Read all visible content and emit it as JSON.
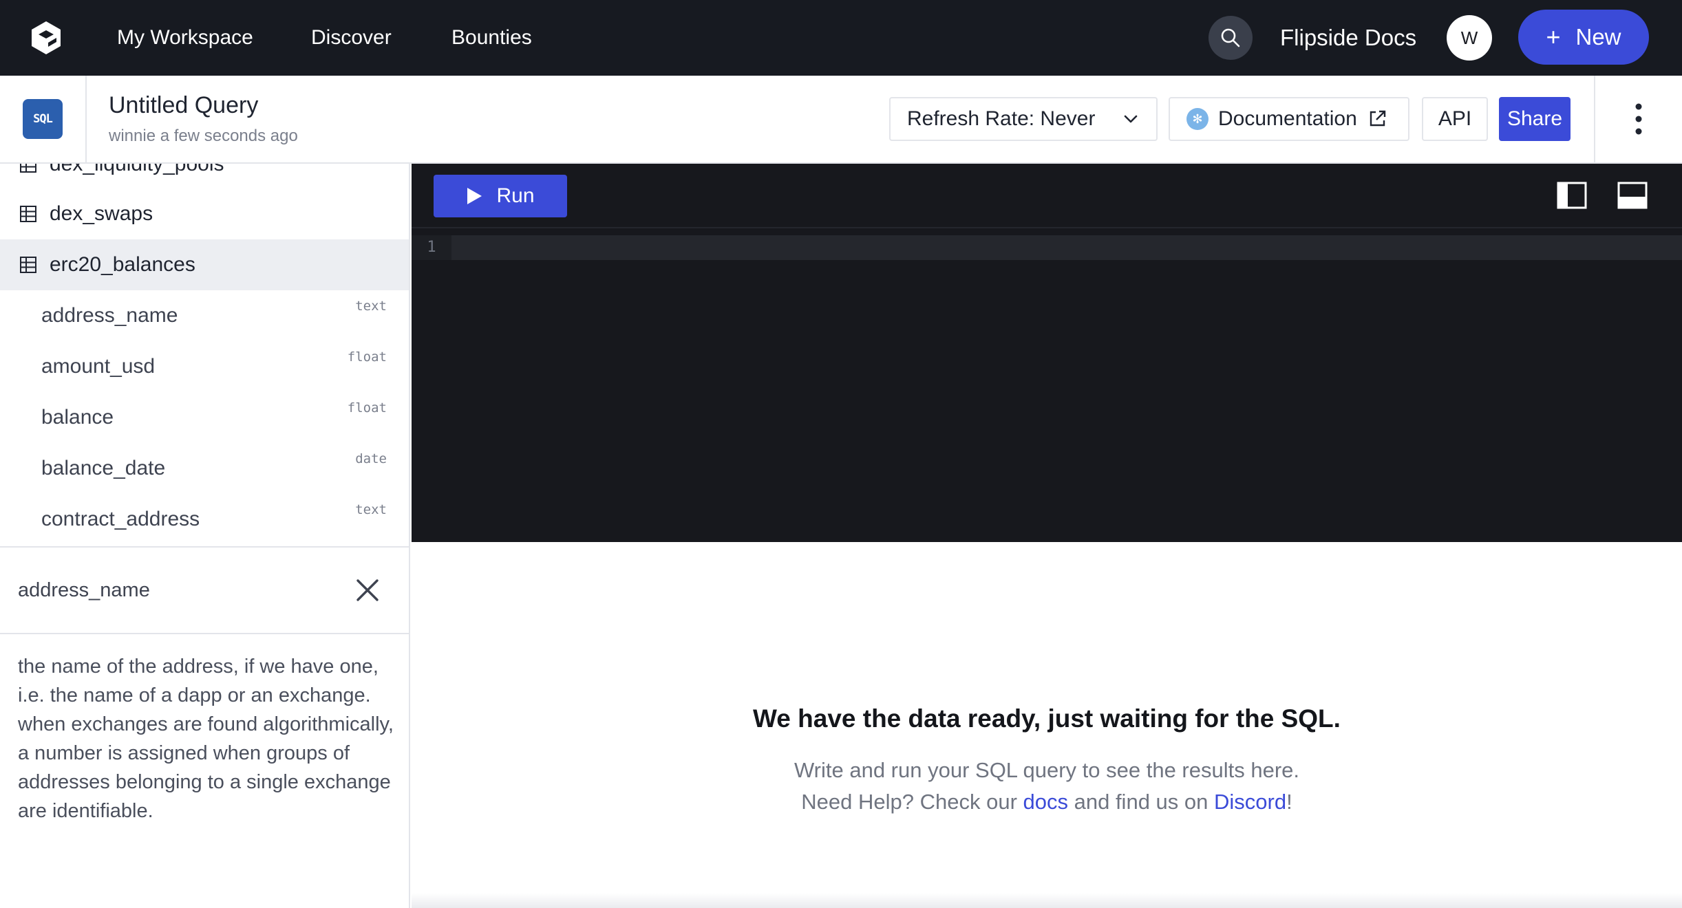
{
  "nav": {
    "links": [
      "My Workspace",
      "Discover",
      "Bounties"
    ],
    "docs_label": "Flipside Docs",
    "avatar_initial": "W",
    "new_label": "New"
  },
  "query": {
    "badge": "SQL",
    "title": "Untitled Query",
    "subtitle": "winnie a few seconds ago",
    "refresh_label": "Refresh Rate: Never",
    "documentation_label": "Documentation",
    "api_label": "API",
    "share_label": "Share"
  },
  "schema": {
    "tables": [
      "dex_liquidity_pools",
      "dex_swaps",
      "erc20_balances"
    ],
    "columns": [
      {
        "name": "address_name",
        "type": "text"
      },
      {
        "name": "amount_usd",
        "type": "float"
      },
      {
        "name": "balance",
        "type": "float"
      },
      {
        "name": "balance_date",
        "type": "date"
      },
      {
        "name": "contract_address",
        "type": "text"
      }
    ]
  },
  "detail": {
    "title": "address_name",
    "description": "the name of the address, if we have one, i.e. the name of a dapp or an exchange. when exchanges are found algorithmically, a number is assigned when groups of addresses belonging to a single exchange are identifiable."
  },
  "editor": {
    "run_label": "Run",
    "line_number": "1"
  },
  "results": {
    "title": "We have the data ready, just waiting for the SQL.",
    "line1": "Write and run your SQL query to see the results here.",
    "line2_pre": "Need Help? Check our ",
    "docs_link": "docs",
    "line2_mid": " and find us on ",
    "discord_link": "Discord",
    "line2_post": "!"
  },
  "colors": {
    "accent": "#3b4bd8",
    "nav_bg": "#171a21",
    "editor_bg": "#17181d"
  }
}
